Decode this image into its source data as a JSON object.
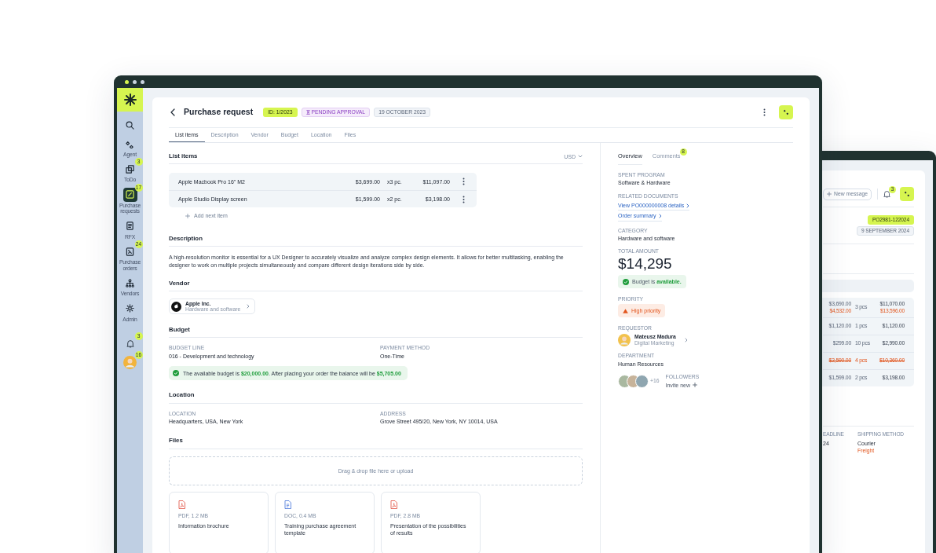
{
  "front_window": {
    "sidebar": {
      "items": [
        {
          "label": "Agent",
          "selected": false
        },
        {
          "label": "ToDo",
          "badge": "3",
          "selected": false
        },
        {
          "label": "Purchase requests",
          "badge": "17",
          "selected": true
        },
        {
          "label": "RFX",
          "selected": false
        },
        {
          "label": "Purchase orders",
          "badge": "24",
          "selected": false
        },
        {
          "label": "Vendors",
          "selected": false
        },
        {
          "label": "Admin",
          "selected": false
        }
      ],
      "notifications_badge": "3",
      "avatar_badge": "16"
    },
    "header": {
      "title": "Purchase request",
      "tags": [
        {
          "text": "ID: 1/2023",
          "kind": "id"
        },
        {
          "text": "PENDING APPROVAL",
          "kind": "status"
        },
        {
          "text": "19 OCTOBER 2023",
          "kind": "date"
        }
      ]
    },
    "tabs": [
      {
        "label": "List items",
        "selected": true
      },
      {
        "label": "Description",
        "selected": false
      },
      {
        "label": "Vendor",
        "selected": false
      },
      {
        "label": "Budget",
        "selected": false
      },
      {
        "label": "Location",
        "selected": false
      },
      {
        "label": "Files",
        "selected": false
      }
    ],
    "list_items": {
      "title": "List items",
      "currency": "USD",
      "rows": [
        {
          "name": "Apple Macbook Pro 16\" M2",
          "price": "$3,699.00",
          "quantity": "x3 pc.",
          "total": "$11,097.00"
        },
        {
          "name": "Apple Studio Display screen",
          "price": "$1,599.00",
          "quantity": "x2 pc.",
          "total": "$3,198.00"
        }
      ],
      "add_label": "Add next item"
    },
    "description": {
      "title": "Description",
      "text": "A high-resolution monitor is essential for a UX Designer to accurately visualize and analyze complex design elements. It allows for better multitasking, enabling the designer to work on multiple projects simultaneously and compare different design iterations side by side."
    },
    "vendor": {
      "title": "Vendor",
      "name": "Apple Inc.",
      "subtitle": "Hardware and software"
    },
    "budget": {
      "title": "Budget",
      "fields": [
        {
          "label": "BUDGET LINE",
          "value": "016 - Development and technology"
        },
        {
          "label": "PAYMENT METHOD",
          "value": "One-Time"
        }
      ],
      "alert": "The available budget is **$20,000.00**. After placing your order the balance will be **$5,705.00**"
    },
    "location": {
      "title": "Location",
      "fields": [
        {
          "label": "LOCATION",
          "value": "Headquarters, USA, New York"
        },
        {
          "label": "ADDRESS",
          "value": "Grove Street 495/20, New York, NY 10014, USA"
        }
      ]
    },
    "files": {
      "title": "Files",
      "dropzone": "Drag & drop file here or upload",
      "items": [
        {
          "kind": "pdf",
          "meta": "PDF, 1.2 MB",
          "name": "Information brochure"
        },
        {
          "kind": "doc",
          "meta": "DOC, 0.4 MB",
          "name": "Training purchase agreement template"
        },
        {
          "kind": "pdf",
          "meta": "PDF, 2.8 MB",
          "name": "Presentation of the possibilities of results"
        }
      ]
    },
    "overview": {
      "tabs": [
        {
          "label": "Overview",
          "selected": true
        },
        {
          "label": "Comments",
          "badge": "8",
          "selected": false
        }
      ],
      "spent_program": {
        "label": "SPENT PROGRAM",
        "value": "Software & Hardware"
      },
      "related_documents": {
        "label": "RELATED DOCUMENTS",
        "links": [
          "View PO000000008 details",
          "Order summary"
        ]
      },
      "category": {
        "label": "CATEGORY",
        "value": "Hardware and software"
      },
      "total_amount": {
        "label": "TOTAL AMOUNT",
        "value": "$14,295",
        "budget_badge": "Budget is **available.**"
      },
      "priority": {
        "label": "PRIORITY",
        "value": "High priority"
      },
      "requestor": {
        "label": "REQUESTOR",
        "name": "Mateusz Madura",
        "role": "Digital Marketing"
      },
      "department": {
        "label": "DEPARTMENT",
        "value": "Human Resources"
      },
      "followers": {
        "label": "FOLLOWERS",
        "more": "+16",
        "invite": "Invite new"
      }
    }
  },
  "back_window": {
    "new_message": "New message",
    "notifications_badge": "3",
    "tags": [
      {
        "text": "PO2981-122024",
        "kind": "id"
      },
      {
        "text": "9 SEPTEMBER 2024",
        "kind": "date"
      }
    ],
    "rows": [
      {
        "price": "$3,690.00",
        "new_price": "$4,532.00",
        "quantity": "3 pcs",
        "total": "$11,070.00",
        "new_total": "$13,596.00",
        "removed": false
      },
      {
        "price": "$1,120.00",
        "quantity": "1 pcs",
        "total": "$1,120.00",
        "removed": false
      },
      {
        "price": "$299.00",
        "quantity": "10 pcs",
        "total": "$2,990.00",
        "removed": false
      },
      {
        "price": "$2,590.00",
        "quantity": "4 pcs",
        "total": "$10,360.00",
        "removed": true
      },
      {
        "price": "$1,599.00",
        "quantity": "2 pcs",
        "total": "$3,198.00",
        "removed": false
      }
    ],
    "fields": [
      {
        "label": "EADLINE",
        "value": "24"
      },
      {
        "label": "SHIPPING METHOD",
        "value": "Courier",
        "note": "Freight"
      }
    ]
  }
}
